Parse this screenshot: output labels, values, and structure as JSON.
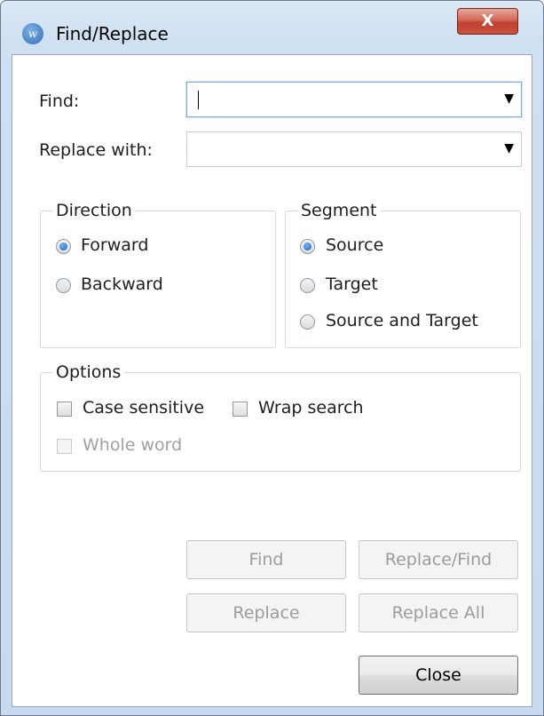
{
  "window": {
    "title": "Find/Replace",
    "app_icon_letter": "w",
    "close_glyph": "X"
  },
  "find": {
    "label": "Find:",
    "value": "",
    "dropdown_glyph": "▼"
  },
  "replace": {
    "label": "Replace with:",
    "value": "",
    "dropdown_glyph": "▼"
  },
  "direction": {
    "legend": "Direction",
    "options": [
      {
        "label": "Forward",
        "selected": true
      },
      {
        "label": "Backward",
        "selected": false
      }
    ]
  },
  "segment": {
    "legend": "Segment",
    "options": [
      {
        "label": "Source",
        "selected": true
      },
      {
        "label": "Target",
        "selected": false
      },
      {
        "label": "Source and Target",
        "selected": false
      }
    ]
  },
  "options": {
    "legend": "Options",
    "case_sensitive": {
      "label": "Case sensitive",
      "checked": false,
      "enabled": true
    },
    "wrap_search": {
      "label": "Wrap search",
      "checked": false,
      "enabled": true
    },
    "whole_word": {
      "label": "Whole word",
      "checked": false,
      "enabled": false
    }
  },
  "buttons": {
    "find": {
      "label": "Find",
      "enabled": false
    },
    "replace_find": {
      "label": "Replace/Find",
      "enabled": false
    },
    "replace": {
      "label": "Replace",
      "enabled": false
    },
    "replace_all": {
      "label": "Replace All",
      "enabled": false
    },
    "close": {
      "label": "Close",
      "enabled": true
    }
  }
}
